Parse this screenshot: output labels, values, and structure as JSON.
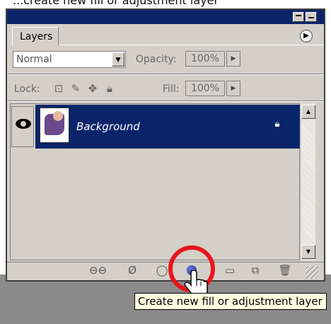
{
  "caption_top": "...create new fill or adjustment layer",
  "panel": {
    "tab_label": "Layers",
    "menu_icon": "flyout-menu-icon",
    "blend_mode": "Normal",
    "opacity_label": "Opacity:",
    "opacity_value": "100%",
    "lock_label": "Lock:",
    "fill_label": "Fill:",
    "fill_value": "100%"
  },
  "layers": [
    {
      "name": "Background",
      "visible": true,
      "locked": true,
      "selected": true
    }
  ],
  "bottom_icons": [
    "link-layers-icon",
    "layer-style-icon",
    "layer-mask-icon",
    "adjustment-layer-icon",
    "new-group-icon",
    "new-layer-icon",
    "delete-layer-icon"
  ],
  "tooltip": "Create new fill or adjustment layer",
  "colors": {
    "selection": "#0a246a",
    "highlight_ring": "#e8151b",
    "panel_bg": "#d4d0c8"
  }
}
